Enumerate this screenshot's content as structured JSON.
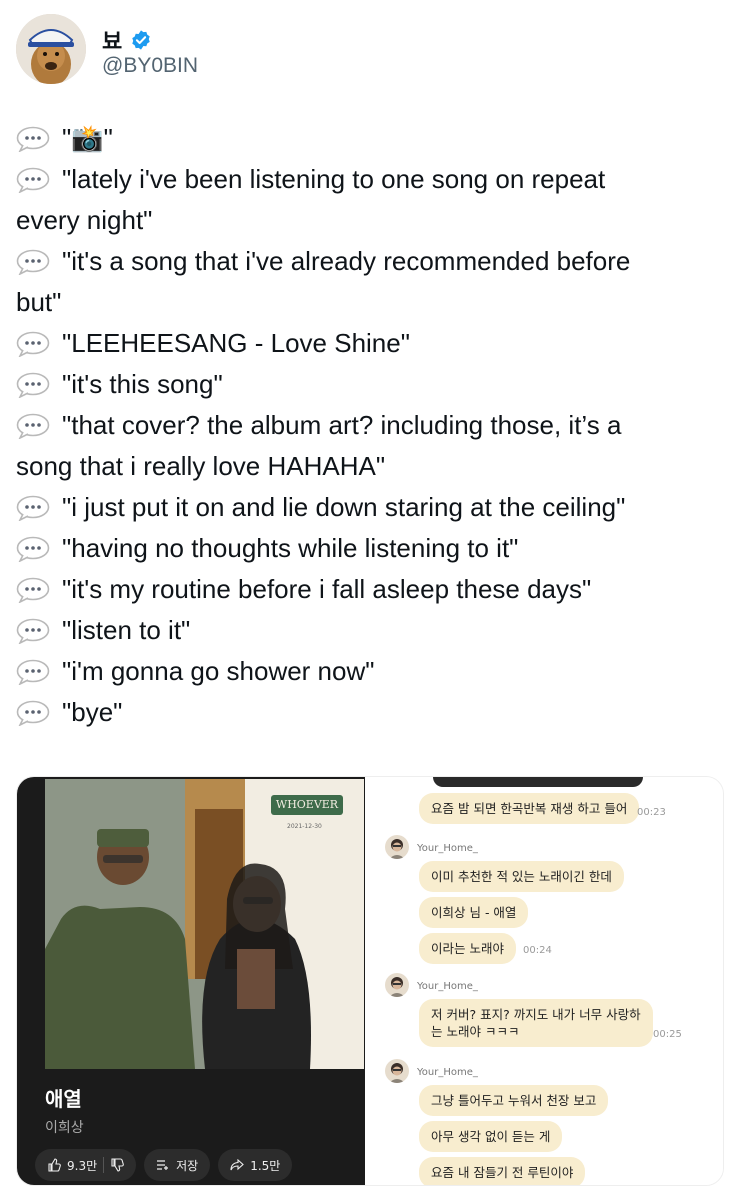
{
  "author": {
    "display_name": "뵤",
    "handle": "@BY0BIN",
    "verified": true,
    "avatar_icon": "dog-wearing-cap-avatar"
  },
  "tweet": {
    "lines": [
      "\"📸\"",
      "\"lately i've been listening to one song on repeat",
      "every night\"",
      "\"it's a song that i've already recommended before",
      "but\"",
      "\"LEEHEESANG - Love Shine\"",
      "\"it's this song\"",
      "\"that cover? the album art? including those, it’s a",
      "song that i really love HAHAHA\"",
      "\"i just put it on and lie down staring at the ceiling\"",
      "\"having no thoughts while listening to it\"",
      "\"it's my routine before i fall asleep these days\"",
      "\"listen to it\"",
      "\"i'm gonna go shower now\"",
      "\"bye\""
    ],
    "bubble_icon": "speech-balloon-icon"
  },
  "music_player": {
    "album_logo": "WHOEVER",
    "album_date": "2021-12-30",
    "song_title": "애열",
    "artist": "이희상",
    "likes": "9.3만",
    "save_label": "저장",
    "shares": "1.5만"
  },
  "chat": {
    "sender": "Your_Home_",
    "messages": [
      {
        "text": "요즘 밤 되면 한곡반복 재생 하고 들어",
        "time": "00:23"
      },
      {
        "text": "이미 추천한 적 있는 노래이긴 한데",
        "time": ""
      },
      {
        "text": "이희상 님 - 애열",
        "time": ""
      },
      {
        "text": "이라는 노래야",
        "time": "00:24"
      },
      {
        "text": "저 커버? 표지? 까지도 내가 너무 사랑하\n는 노래야 ㅋㅋㅋ",
        "time": "00:25"
      },
      {
        "text": "그냥 틀어두고 누워서 천장 보고",
        "time": ""
      },
      {
        "text": "아무 생각 없이 듣는 게",
        "time": ""
      },
      {
        "text": "요즘 내 잠들기 전 루틴이야",
        "time": ""
      }
    ]
  },
  "colors": {
    "verified_blue": "#1d9bf0",
    "chat_bubble": "#f8edcf",
    "text": "#0f1419",
    "handle_gray": "#536471"
  }
}
